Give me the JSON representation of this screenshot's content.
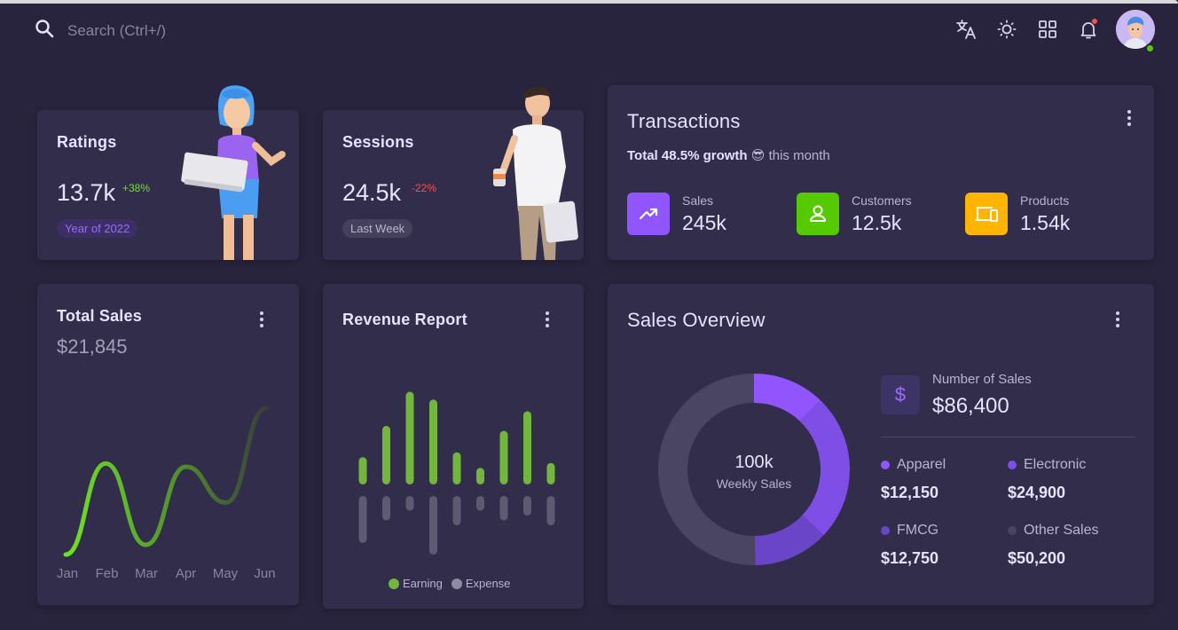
{
  "search": {
    "placeholder": "Search (Ctrl+/)"
  },
  "topbar": {
    "icons": [
      "search-icon",
      "translate-icon",
      "theme-icon",
      "apps-grid-icon",
      "bell-icon",
      "avatar"
    ]
  },
  "ratings": {
    "title": "Ratings",
    "value": "13.7k",
    "change": "+38%",
    "chip": "Year of 2022"
  },
  "sessions": {
    "title": "Sessions",
    "value": "24.5k",
    "change": "-22%",
    "chip": "Last Week"
  },
  "transactions": {
    "title": "Transactions",
    "growth_bold": "Total 48.5% growth",
    "growth_emoji": "😎",
    "growth_rest": "this month",
    "items": [
      {
        "label": "Sales",
        "value": "245k",
        "icon": "trending-up-icon",
        "color": "#9155fd"
      },
      {
        "label": "Customers",
        "value": "12.5k",
        "icon": "user-icon",
        "color": "#56ca00"
      },
      {
        "label": "Products",
        "value": "1.54k",
        "icon": "devices-icon",
        "color": "#ffb400"
      }
    ]
  },
  "total_sales": {
    "title": "Total Sales",
    "value": "$21,845",
    "months": [
      "Jan",
      "Feb",
      "Mar",
      "Apr",
      "May",
      "Jun"
    ]
  },
  "revenue": {
    "title": "Revenue Report",
    "legend": [
      "Earning",
      "Expense"
    ]
  },
  "sales_overview": {
    "title": "Sales Overview",
    "center_value": "100k",
    "center_label": "Weekly Sales",
    "number_label": "Number of Sales",
    "number_value": "$86,400",
    "currency_icon": "dollar-icon",
    "legend": [
      {
        "label": "Apparel",
        "value": "$12,150",
        "color": "#9155fd"
      },
      {
        "label": "Electronic",
        "value": "$24,900",
        "color": "#7e4ee6"
      },
      {
        "label": "FMCG",
        "value": "$12,750",
        "color": "#6b45c8"
      },
      {
        "label": "Other Sales",
        "value": "$50,200",
        "color": "#4a4563"
      }
    ]
  },
  "chart_data": [
    {
      "type": "line",
      "title": "Total Sales",
      "categories": [
        "Jan",
        "Feb",
        "Mar",
        "Apr",
        "May",
        "Jun"
      ],
      "series": [
        {
          "values": [
            0,
            28,
            3,
            27,
            16,
            45
          ]
        }
      ]
    },
    {
      "type": "bar",
      "title": "Revenue Report",
      "series": [
        {
          "name": "Earning",
          "values": [
            28,
            60,
            95,
            87,
            33,
            17,
            55,
            75,
            22
          ]
        },
        {
          "name": "Expense",
          "values": [
            -48,
            -25,
            -15,
            -60,
            -30,
            -15,
            -25,
            -20,
            -30
          ]
        }
      ],
      "colors": {
        "Earning": "#72b63d",
        "Expense": "#5e5a74"
      }
    },
    {
      "type": "pie",
      "title": "Sales Overview",
      "categories": [
        "Apparel",
        "Electronic",
        "FMCG",
        "Other Sales"
      ],
      "values": [
        12150,
        24900,
        12750,
        50200
      ]
    }
  ]
}
